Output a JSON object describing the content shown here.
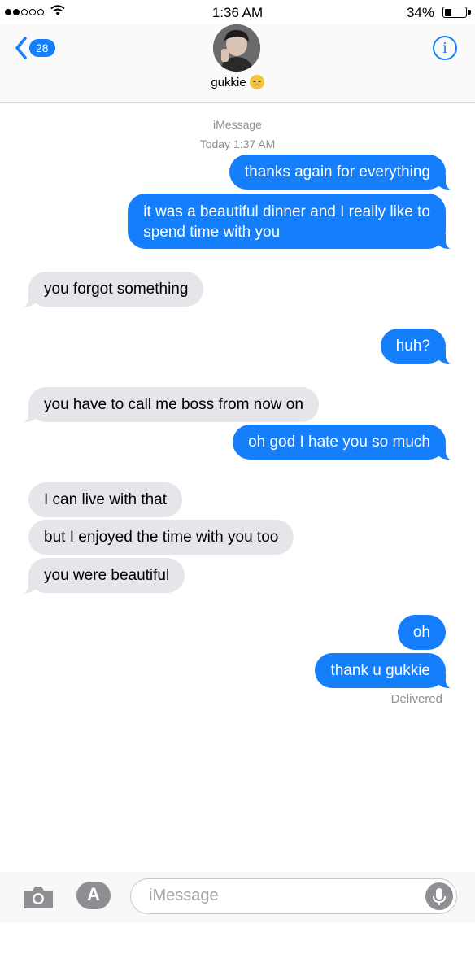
{
  "status_bar": {
    "time": "1:36 AM",
    "battery_pct": "34%",
    "battery_level": 0.34,
    "signal_bars": 2
  },
  "header": {
    "back_count": "28",
    "contact_name": "gukkie",
    "info_label": "i"
  },
  "thread": {
    "service": "iMessage",
    "timestamp_day": "Today",
    "timestamp_time": "1:37 AM"
  },
  "messages": [
    {
      "dir": "out",
      "text": "thanks again for everything"
    },
    {
      "dir": "out",
      "text": "it was a beautiful dinner and I really like to"
    },
    {
      "dir": "out",
      "text": "spend time with you"
    },
    {
      "dir": "in",
      "text": "you forgot something"
    },
    {
      "dir": "out",
      "text": "huh?"
    },
    {
      "dir": "in",
      "text": "you have to call me boss from now on"
    },
    {
      "dir": "out",
      "text": "oh god I hate you so much"
    },
    {
      "dir": "in",
      "text": "I can live with that"
    },
    {
      "dir": "in",
      "text": "but I enjoyed the time with you too"
    },
    {
      "dir": "in",
      "text": "you were beautiful"
    },
    {
      "dir": "out",
      "text": "oh"
    },
    {
      "dir": "out",
      "text": "thank u gukkie"
    }
  ],
  "delivered_label": "Delivered",
  "composer": {
    "placeholder": "iMessage"
  },
  "colors": {
    "accent": "#147efb",
    "incoming_bubble": "#e5e5ea",
    "meta_text": "#8e8e93"
  }
}
